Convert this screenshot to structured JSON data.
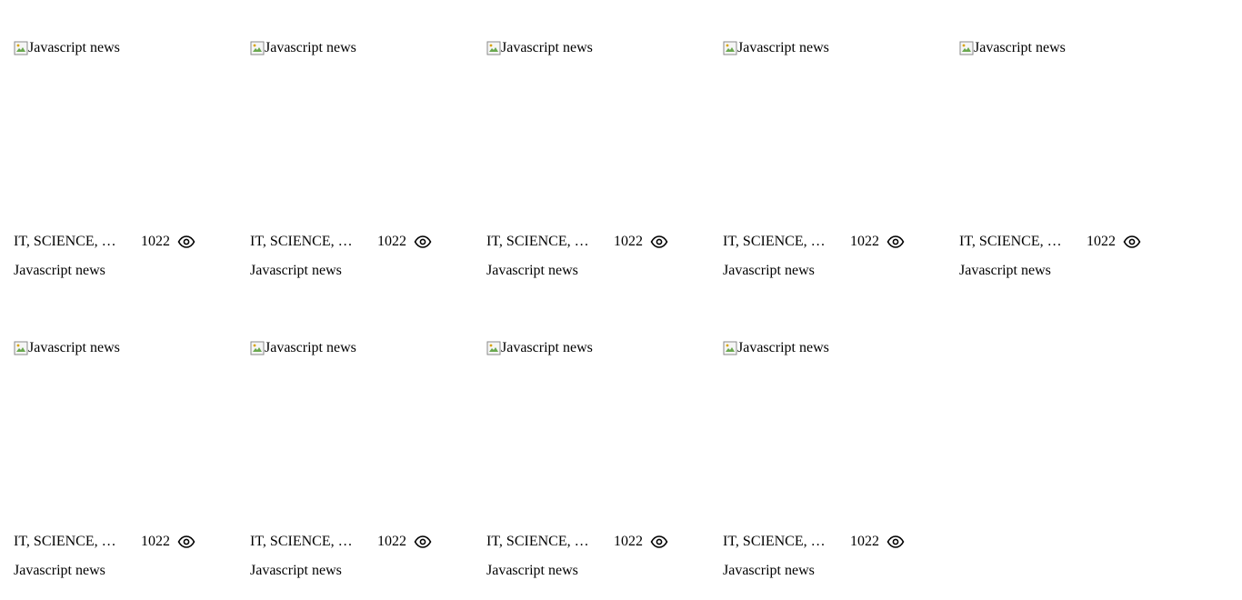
{
  "cards": [
    {
      "alt": "Javascript news",
      "category": "IT, SCIENCE, …",
      "views": "1022",
      "title": "Javascript news"
    },
    {
      "alt": "Javascript news",
      "category": "IT, SCIENCE, …",
      "views": "1022",
      "title": "Javascript news"
    },
    {
      "alt": "Javascript news",
      "category": "IT, SCIENCE, …",
      "views": "1022",
      "title": "Javascript news"
    },
    {
      "alt": "Javascript news",
      "category": "IT, SCIENCE, …",
      "views": "1022",
      "title": "Javascript news"
    },
    {
      "alt": "Javascript news",
      "category": "IT, SCIENCE, …",
      "views": "1022",
      "title": "Javascript news"
    },
    {
      "alt": "Javascript news",
      "category": "IT, SCIENCE, …",
      "views": "1022",
      "title": "Javascript news"
    },
    {
      "alt": "Javascript news",
      "category": "IT, SCIENCE, …",
      "views": "1022",
      "title": "Javascript news"
    },
    {
      "alt": "Javascript news",
      "category": "IT, SCIENCE, …",
      "views": "1022",
      "title": "Javascript news"
    },
    {
      "alt": "Javascript news",
      "category": "IT, SCIENCE, …",
      "views": "1022",
      "title": "Javascript news"
    }
  ],
  "icons": {
    "views": "eye-icon",
    "image_placeholder": "broken-image-icon"
  }
}
